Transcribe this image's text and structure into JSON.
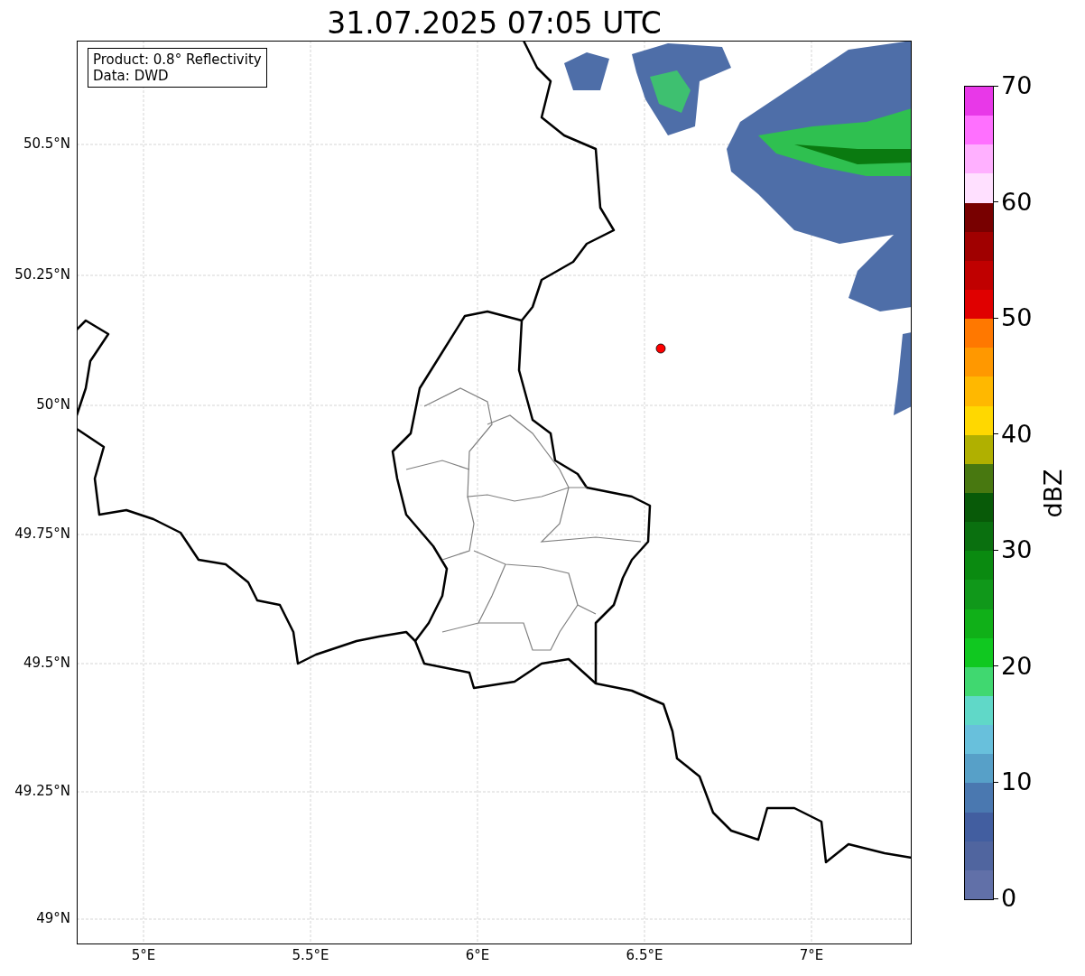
{
  "title": "31.07.2025 07:05 UTC",
  "info_box": {
    "lines": [
      "Product: 0.8° Reflectivity",
      "Data: DWD"
    ]
  },
  "map": {
    "y_ticks": [
      "50.5°N",
      "50.25°N",
      "50°N",
      "49.75°N",
      "49.5°N",
      "49.25°N",
      "49°N"
    ],
    "x_ticks": [
      "5°E",
      "5.5°E",
      "6°E",
      "6.5°E",
      "7°E"
    ]
  },
  "colorbar": {
    "label": "dBZ",
    "ticks": [
      "70",
      "60",
      "50",
      "40",
      "30",
      "20",
      "10",
      "0"
    ],
    "bins": [
      {
        "color": "#e838e8"
      },
      {
        "color": "#ff70ff"
      },
      {
        "color": "#ffb0ff"
      },
      {
        "color": "#ffe0ff"
      },
      {
        "color": "#780000"
      },
      {
        "color": "#a00000"
      },
      {
        "color": "#c00000"
      },
      {
        "color": "#e00000"
      },
      {
        "color": "#ff7800"
      },
      {
        "color": "#ff9800"
      },
      {
        "color": "#ffb800"
      },
      {
        "color": "#ffd800"
      },
      {
        "color": "#b0b000"
      },
      {
        "color": "#487810"
      },
      {
        "color": "#085a08"
      },
      {
        "color": "#0a700f"
      },
      {
        "color": "#0a8a10"
      },
      {
        "color": "#10981a"
      },
      {
        "color": "#10b018"
      },
      {
        "color": "#10c820"
      },
      {
        "color": "#40d870"
      },
      {
        "color": "#60d8c8"
      },
      {
        "color": "#68c0dc"
      },
      {
        "color": "#57a0c8"
      },
      {
        "color": "#4a78b0"
      },
      {
        "color": "#425ea0"
      },
      {
        "color": "#50659f"
      },
      {
        "color": "#6170a8"
      }
    ]
  }
}
